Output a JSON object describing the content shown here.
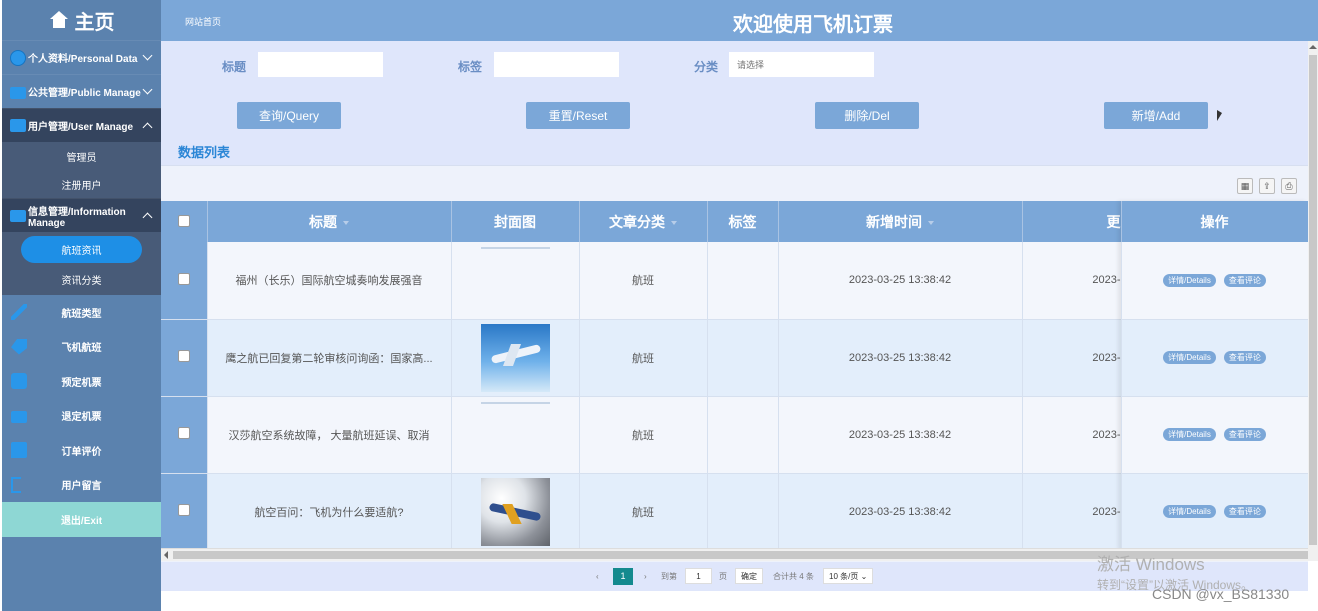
{
  "sidebar": {
    "brand": "主页",
    "groups": [
      {
        "label": "个人资料/Personal Data"
      },
      {
        "label": "公共管理/Public Manage"
      },
      {
        "label": "用户管理/User Manage"
      },
      {
        "label": "信息管理/Information Manage"
      }
    ],
    "user_sub": [
      "管理员",
      "注册用户"
    ],
    "info_sub": [
      "航班资讯",
      "资讯分类"
    ],
    "items": [
      "航班类型",
      "飞机航班",
      "预定机票",
      "退定机票",
      "订单评价",
      "用户留言"
    ],
    "exit": "退出/Exit"
  },
  "header": {
    "breadcrumb": "网站首页",
    "title": "欢迎使用飞机订票"
  },
  "search": {
    "title_label": "标题",
    "tag_label": "标签",
    "category_label": "分类",
    "category_placeholder": "请选择"
  },
  "buttons": {
    "query": "查询/Query",
    "reset": "重置/Reset",
    "delete": "删除/Del",
    "add": "新增/Add"
  },
  "list_title": "数据列表",
  "table": {
    "columns": [
      "标题",
      "封面图",
      "文章分类",
      "标签",
      "新增时间",
      "更",
      "操作"
    ],
    "rows": [
      {
        "title": "福州（长乐）国际航空城奏响发展强音",
        "category": "航班",
        "tag": "",
        "time": "2023-03-25 13:38:42",
        "updated": "2023-"
      },
      {
        "title": "鹰之航已回复第二轮审核问询函：国家高...",
        "category": "航班",
        "tag": "",
        "time": "2023-03-25 13:38:42",
        "updated": "2023-"
      },
      {
        "title": "汉莎航空系统故障， 大量航班延误、取消",
        "category": "航班",
        "tag": "",
        "time": "2023-03-25 13:38:42",
        "updated": "2023-"
      },
      {
        "title": "航空百问：飞机为什么要适航?",
        "category": "航班",
        "tag": "",
        "time": "2023-03-25 13:38:42",
        "updated": "2023-"
      }
    ],
    "op_details": "详情/Details",
    "op_comments": "查看评论"
  },
  "pager": {
    "current": "1",
    "goto_label": "到第",
    "goto_value": "1",
    "page_label": "页",
    "confirm": "确定",
    "total": "合计共 4 条",
    "page_size": "10 条/页"
  },
  "watermark": {
    "line1": "激活 Windows",
    "line2": "转到“设置”以激活 Windows。"
  },
  "csdn": "CSDN @vx_BS81330"
}
